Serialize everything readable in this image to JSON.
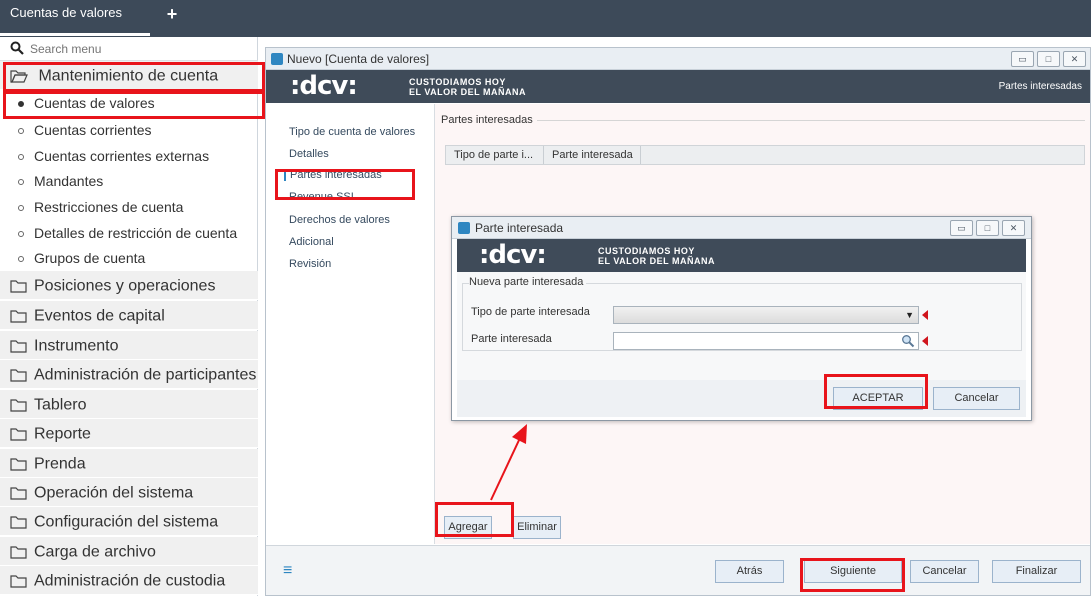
{
  "app_tab": {
    "label": "Cuentas de valores",
    "plus": "+"
  },
  "search": {
    "placeholder": "Search menu"
  },
  "menu": {
    "expanded_section": "Mantenimiento de cuenta",
    "subitems": [
      "Cuentas de valores",
      "Cuentas corrientes",
      "Cuentas corrientes externas",
      "Mandantes",
      "Restricciones de cuenta",
      "Detalles de restricción de cuenta",
      "Grupos de cuenta"
    ],
    "sections": [
      "Posiciones y operaciones",
      "Eventos de capital",
      "Instrumento",
      "Administración de participantes",
      "Tablero",
      "Reporte",
      "Prenda",
      "Operación del sistema",
      "Configuración del sistema",
      "Carga de archivo",
      "Administración de custodia"
    ]
  },
  "window": {
    "title": "Nuevo [Cuenta de valores]",
    "logo": ":dcv:",
    "tagline_1": "CUSTODIAMOS HOY",
    "tagline_2": "EL VALOR DEL MAÑANA",
    "banner_right": "Partes interesadas",
    "steps": [
      "Tipo de cuenta de valores",
      "Detalles",
      "Partes interesadas",
      "Revenue SSI",
      "Derechos de valores",
      "Adicional",
      "Revisión"
    ],
    "fieldset_title": "Partes interesadas",
    "grid_columns": [
      "Tipo de parte i...",
      "Parte interesada"
    ],
    "section_buttons": {
      "add": "Agregar",
      "delete": "Eliminar"
    },
    "footer_buttons": {
      "back": "Atrás",
      "next": "Siguiente",
      "cancel": "Cancelar",
      "finish": "Finalizar"
    }
  },
  "dialog": {
    "title": "Parte interesada",
    "fieldset_title": "Nueva parte interesada",
    "field_type_label": "Tipo de parte interesada",
    "field_party_label": "Parte interesada",
    "accept": "ACEPTAR",
    "cancel": "Cancelar"
  },
  "colors": {
    "topbar": "#3d4a59",
    "banner": "#3f4b59",
    "highlight": "#e8141b",
    "accent": "#2e86c1"
  }
}
